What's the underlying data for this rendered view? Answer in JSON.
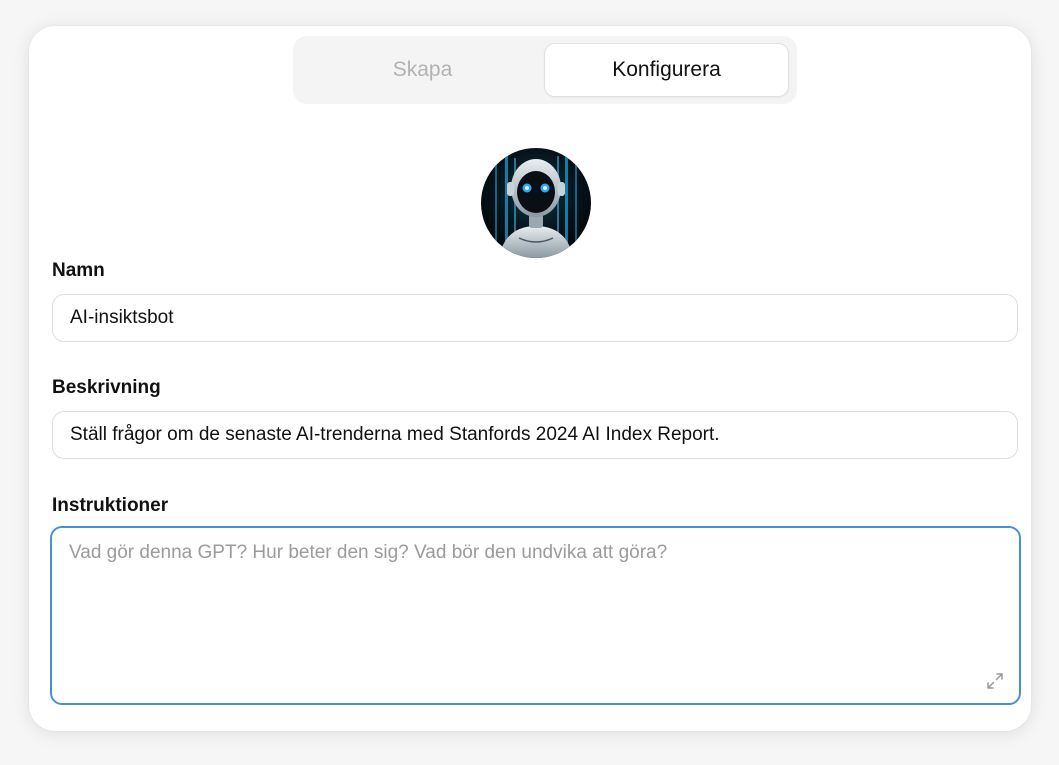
{
  "tabs": [
    {
      "label": "Skapa",
      "active": false
    },
    {
      "label": "Konfigurera",
      "active": true
    }
  ],
  "avatar": {
    "icon": "robot-avatar-icon"
  },
  "fields": {
    "name": {
      "label": "Namn",
      "value": "AI-insiktsbot"
    },
    "description": {
      "label": "Beskrivning",
      "value": "Ställ frågor om de senaste AI-trenderna med Stanfords 2024 AI Index Report."
    },
    "instructions": {
      "label": "Instruktioner",
      "value": "",
      "placeholder": "Vad gör denna GPT? Hur beter den sig? Vad bör den undvika att göra?"
    }
  },
  "colors": {
    "focus_border": "#4a8fd4",
    "robot_eyes": "#2aa8ff"
  }
}
